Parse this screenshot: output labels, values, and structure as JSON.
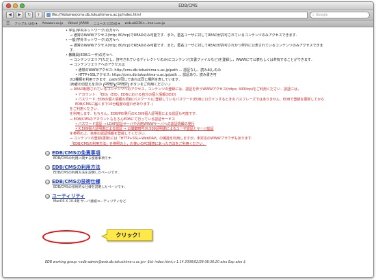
{
  "window": {
    "title": "EDB/CMS"
  },
  "toolbar": {
    "back": "◀",
    "forward": "▶",
    "reload": "↻",
    "add": "+",
    "url": "file:///Volumes/cms.db.tokushima-u.ac.jp/index.html",
    "search_placeholder": "Google"
  },
  "bookmarks": [
    "アップル (24) ▾",
    "Amazon.co.jp",
    "Yahoo! JAPAN",
    "ニュース (1554) ▾",
    "web.ait230.t...ima-u.ac.jp"
  ],
  "content": {
    "lines": [
      "学生(学内ネットワーク)の方々へ",
      "⇒ 通常のWWWアクセス(http; 80/tcp)でREADのみ可能です．また，匿名ユーザに対してREADが許可されているコンテンツのみアクセスできます．",
      "一般(学外ネットワーク)の方々へ",
      "⇒ 通常のWWWアクセス(http; 80/tcp)でREADのみ可能です．また，匿名ユーザに対してREADが許可されかつ学外に公表されているコンテンツのみアクセスできます．",
      "教職員(EDBユーザ)の方々へ",
      "⇒ コンテンツエリア(ただし，許可されているディレクトリのみ)にコンテンツ(文書ファイルなど)を登録し，WWWにて公表もしくは共有することができます．",
      "⇒ コンテンツエリアへのアクセスは"
    ],
    "access_items": [
      "通常のWWWアクセス: http://cms.db.tokushima-u.ac.jp/path … 認証なし，読み出しのみ",
      "HTTP+SSLアクセス: https://cms.db.tokushima-u.ac.jp/path … 認証あり，読み書き可"
    ],
    "switch_line": "の2種類を利用できます．pathが同じであれば同じ場所を表しています．",
    "switch_line2_a": "(両者の切替えを次の",
    "switch_btn1": "⇒http",
    "switch_btn2": "⇒https",
    "switch_line2_b": "ボタンをご利用ください．)",
    "red_lines": [
      "⇒ READ制限されているコンテンツへのアクセス，コンテンツの登録には，認証を伴うWWWアクセス(https; 443/tcp)をご利用ください．認証には，",
      "アカウント: 「EID」(EID，EDBにおける自分の個人情報のEID)",
      "パスワード: EDBの個人情報の項目(パスワード)に登録しているパスワード(EDBにログインするときのパスフレーズではありません．EDBで登録を更新してからEDB/CMSに届くまで10分程度の遅れがあります．)",
      "をご利用ください．",
      "を利用します．もちろん，EDB/PKI発行のX.509個人証明書による認証も可能です．",
      "⇒ EDB/CMSのアカウントもちろんEDBにて行っている認証サービス",
      "パスワード認証 → LDAP認証サーバや汎用WWWサーバへの認証情報の発行",
      "X.509個人証明書による認証 → 公開鍵暗号(X.509証明書によるユーザ認証とサーバ認証",
      "を参照の上，自身の認証情報を登録してください．",
      "⇒ コンテンツの登録(更新)には「HTTP+SSL+WebDAV」の機能を利用しますが，未対応のWWWブラウザもあります．",
      "「EDB/CMSの利用方法」を参照の上，お使いのPC環境にあった方法をご利用ください．"
    ]
  },
  "sections": [
    {
      "title": "EDB/CMSの免責事項",
      "sub": "EDB/CMSの利用に関する留意事項です．"
    },
    {
      "title": "EDB/CMSの利用方法",
      "sub": "EDB/CMSの利用方法を説明したページです．"
    },
    {
      "title": "EDB/CMSの技術仕様",
      "sub": "EDB/CMSの技術的な仕様を説明したページです．"
    },
    {
      "title": "ユーティリティ",
      "sub": "MacOS X 10.4用 サーバ接続ユーティリティなど．"
    }
  ],
  "footer": "EDB working group <edb-admin@web.db.tokushima-u.ac.jp> $Id: index.html,v 1.14 2006/02/28 06:36:20 alex Exp alex $",
  "callout": {
    "text": "クリック！"
  }
}
